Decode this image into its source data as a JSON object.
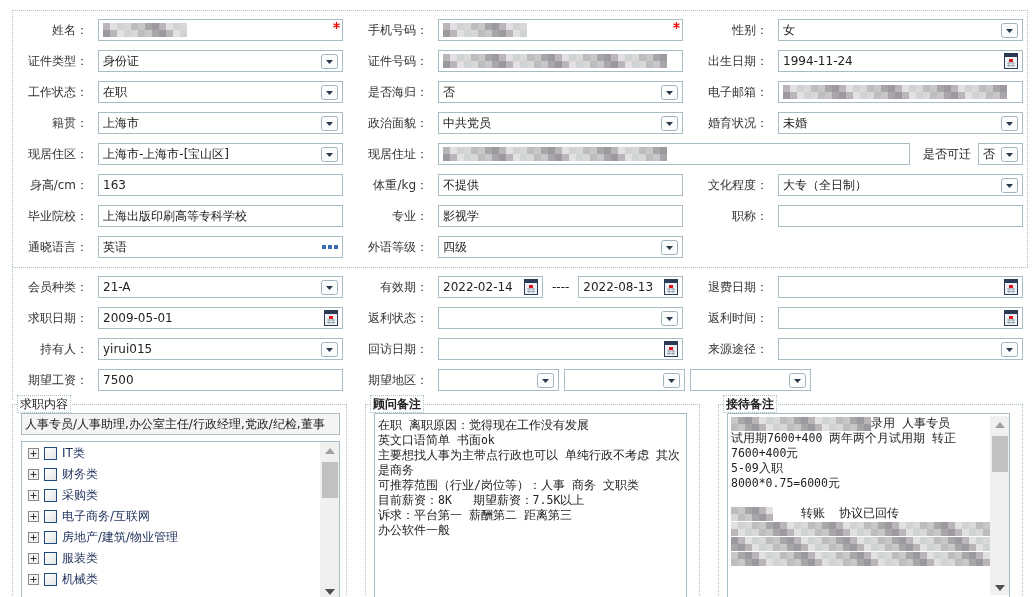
{
  "sections": [
    {
      "rows": [
        {
          "cells": [
            {
              "label": "姓名：",
              "kind": "single",
              "items": [
                {
                  "kind": "text",
                  "redacted": true,
                  "required": true
                }
              ]
            },
            {
              "label": "手机号码：",
              "kind": "single",
              "items": [
                {
                  "kind": "text",
                  "redacted": true,
                  "required": true
                }
              ]
            },
            {
              "label": "性别：",
              "kind": "single",
              "items": [
                {
                  "kind": "select",
                  "value": "女"
                }
              ]
            }
          ]
        },
        {
          "cells": [
            {
              "label": "证件类型：",
              "kind": "single",
              "items": [
                {
                  "kind": "select",
                  "value": "身份证"
                }
              ]
            },
            {
              "label": "证件号码：",
              "kind": "single",
              "items": [
                {
                  "kind": "text",
                  "redacted": true
                }
              ]
            },
            {
              "label": "出生日期：",
              "kind": "single",
              "items": [
                {
                  "kind": "date",
                  "value": "1994-11-24"
                }
              ]
            }
          ]
        },
        {
          "cells": [
            {
              "label": "工作状态：",
              "kind": "single",
              "items": [
                {
                  "kind": "select",
                  "value": "在职"
                }
              ]
            },
            {
              "label": "是否海归：",
              "kind": "single",
              "items": [
                {
                  "kind": "select",
                  "value": "否"
                }
              ]
            },
            {
              "label": "电子邮箱：",
              "kind": "single",
              "items": [
                {
                  "kind": "text",
                  "redacted": true
                }
              ]
            }
          ]
        },
        {
          "cells": [
            {
              "label": "籍贯：",
              "kind": "single",
              "items": [
                {
                  "kind": "select",
                  "value": "上海市"
                }
              ]
            },
            {
              "label": "政治面貌：",
              "kind": "single",
              "items": [
                {
                  "kind": "select",
                  "value": "中共党员"
                }
              ]
            },
            {
              "label": "婚育状况：",
              "kind": "single",
              "items": [
                {
                  "kind": "select",
                  "value": "未婚"
                }
              ]
            }
          ]
        },
        {
          "cells": [
            {
              "label": "现居住区：",
              "kind": "single",
              "items": [
                {
                  "kind": "select",
                  "value": " 上海市-上海市-[宝山区]"
                }
              ]
            },
            {
              "label": "现居住址：",
              "kind": "address",
              "items": [
                {
                  "kind": "text",
                  "redacted": true
                },
                {
                  "kind": "label",
                  "value": "是否可迁"
                },
                {
                  "kind": "select",
                  "value": "否"
                }
              ]
            }
          ]
        },
        {
          "cells": [
            {
              "label": "身高/cm：",
              "kind": "single",
              "items": [
                {
                  "kind": "text",
                  "value": "163"
                }
              ]
            },
            {
              "label": "体重/kg：",
              "kind": "single",
              "items": [
                {
                  "kind": "text",
                  "value": "不提供"
                }
              ]
            },
            {
              "label": "文化程度：",
              "kind": "single",
              "items": [
                {
                  "kind": "select",
                  "value": "大专（全日制）"
                }
              ]
            }
          ]
        },
        {
          "cells": [
            {
              "label": "毕业院校：",
              "kind": "single",
              "items": [
                {
                  "kind": "text",
                  "value": "上海出版印刷高等专科学校"
                }
              ]
            },
            {
              "label": "专业：",
              "kind": "single",
              "items": [
                {
                  "kind": "text",
                  "value": "影视学"
                }
              ]
            },
            {
              "label": "职称：",
              "kind": "single",
              "items": [
                {
                  "kind": "text"
                }
              ]
            }
          ]
        },
        {
          "cells": [
            {
              "label": "通晓语言：",
              "kind": "single",
              "items": [
                {
                  "kind": "more",
                  "value": "英语"
                }
              ]
            },
            {
              "label": "外语等级：",
              "kind": "single",
              "items": [
                {
                  "kind": "select",
                  "value": "四级"
                }
              ]
            }
          ]
        }
      ]
    },
    {
      "rows": [
        {
          "cells": [
            {
              "label": "会员种类：",
              "kind": "single",
              "items": [
                {
                  "kind": "select",
                  "value": " 21-A"
                }
              ]
            },
            {
              "label": "有效期：",
              "kind": "range",
              "items": [
                {
                  "kind": "date",
                  "value": "2022-02-14"
                },
                {
                  "kind": "separator",
                  "value": "----"
                },
                {
                  "kind": "date",
                  "value": "2022-08-13"
                }
              ]
            },
            {
              "label": "退费日期：",
              "kind": "single",
              "items": [
                {
                  "kind": "date"
                }
              ]
            }
          ]
        },
        {
          "cells": [
            {
              "label": "求职日期：",
              "kind": "single",
              "items": [
                {
                  "kind": "date",
                  "value": "2009-05-01"
                }
              ]
            },
            {
              "label": "返利状态：",
              "kind": "single",
              "items": [
                {
                  "kind": "select"
                }
              ]
            },
            {
              "label": "返利时间：",
              "kind": "single",
              "items": [
                {
                  "kind": "date"
                }
              ]
            }
          ]
        },
        {
          "cells": [
            {
              "label": "持有人：",
              "kind": "single",
              "items": [
                {
                  "kind": "select",
                  "value": "yirui015"
                }
              ]
            },
            {
              "label": "回访日期：",
              "kind": "single",
              "items": [
                {
                  "kind": "date"
                }
              ]
            },
            {
              "label": "来源途径：",
              "kind": "single",
              "items": [
                {
                  "kind": "select"
                }
              ]
            }
          ]
        },
        {
          "cells": [
            {
              "label": "期望工资：",
              "kind": "single",
              "items": [
                {
                  "kind": "text",
                  "value": "7500"
                }
              ]
            },
            {
              "label": "期望地区：",
              "kind": "group",
              "items": [
                {
                  "kind": "select"
                },
                {
                  "kind": "select"
                },
                {
                  "kind": "select"
                }
              ]
            }
          ]
        }
      ]
    }
  ],
  "job_content": {
    "title": "求职内容",
    "summary": "人事专员/人事助理,办公室主任/行政经理,党政/纪检,董事",
    "tree": [
      {
        "label": "IT类",
        "expanded": false,
        "checked": false
      },
      {
        "label": "财务类",
        "expanded": false,
        "checked": false
      },
      {
        "label": "采购类",
        "expanded": false,
        "checked": false
      },
      {
        "label": "电子商务/互联网",
        "expanded": false,
        "checked": false
      },
      {
        "label": "房地产/建筑/物业管理",
        "expanded": false,
        "checked": false
      },
      {
        "label": "服装类",
        "expanded": false,
        "checked": false
      },
      {
        "label": "机械类",
        "expanded": false,
        "checked": false
      }
    ]
  },
  "consultant_notes": {
    "title": "顾问备注",
    "lines": [
      "在职 离职原因：觉得现在工作没有发展",
      "英文口语简单 书面ok",
      "主要想找人事为主带点行政也可以 单纯行政不考虑 其次是商务",
      "可推荐范围（行业/岗位等）：人事 商务 文职类",
      "目前薪资：8K   期望薪资：7.5K以上",
      "诉求：平台第一 薪酬第二 距离第三",
      "办公软件一般"
    ]
  },
  "reception_notes": {
    "title": "接待备注",
    "lines": [
      {
        "kind": "redacted-text",
        "text": "录用 人事专员"
      },
      {
        "kind": "text",
        "text": "试用期7600+400 两年两个月试用期 转正7600+400元"
      },
      {
        "kind": "text",
        "text": "5-09入职"
      },
      {
        "kind": "text",
        "text": "8000*0.75=6000元"
      },
      {
        "kind": "blank"
      },
      {
        "kind": "redacted-text",
        "text": "    转账  协议已回传"
      },
      {
        "kind": "redacted"
      },
      {
        "kind": "redacted"
      },
      {
        "kind": "redacted"
      }
    ]
  }
}
